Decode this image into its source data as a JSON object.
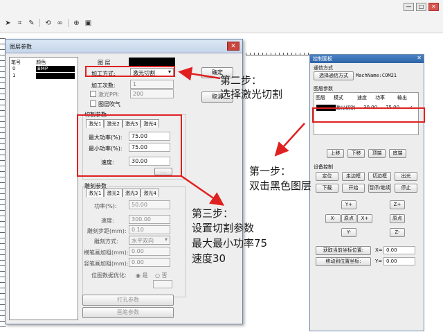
{
  "window": {
    "minimize": "—",
    "maximize": "□",
    "close": "✕"
  },
  "layer_dialog": {
    "title": "图层参数",
    "close": "✕",
    "list_headers": {
      "num": "笔号",
      "color": "颜色"
    },
    "rows": [
      {
        "num": "0",
        "name": "BMP"
      },
      {
        "num": "1",
        "name": ""
      }
    ],
    "layer_label": "图 层",
    "process_mode_label": "加工方式:",
    "process_mode_value": "激光切割",
    "process_count_label": "加工次数:",
    "process_count_value": "1",
    "laser_ppi_label": "激光PPI:",
    "laser_ppi_value": "200",
    "layer_blow_label": "图层吹气",
    "ok_button": "确定",
    "cancel_button": "取消",
    "cut_group_title": "切割参数",
    "cut_tabs": [
      "激光1",
      "激光2",
      "激光3",
      "激光4"
    ],
    "max_power_label": "最大功率(%):",
    "max_power_value": "75.00",
    "min_power_label": "最小功率(%):",
    "min_power_value": "75.00",
    "speed_label": "速度:",
    "speed_value": "30.00",
    "more_button": "....",
    "engrave_group_title": "雕刻参数",
    "engrave_tabs": [
      "激光1",
      "激光2",
      "激光3",
      "激光4"
    ],
    "e_power_label": "功率(%):",
    "e_power_value": "50.00",
    "e_speed_label": "速度:",
    "e_speed_value": "300.00",
    "e_step_label": "雕刻步距(mm):",
    "e_step_value": "0.10",
    "e_mode_label": "雕刻方式:",
    "e_mode_value": "水平双向",
    "e_hbold_label": "横笔画加粗(mm):",
    "e_hbold_value": "0.00",
    "e_vbold_label": "竖笔画加粗(mm):",
    "e_vbold_value": "0.00",
    "e_opt_label": "位图数据优化:",
    "e_opt_yes": "是",
    "e_opt_no": "否",
    "drill_button": "打孔参数",
    "outline_button": "画笔参数"
  },
  "control_panel": {
    "title": "控制面板",
    "comm_label": "通信方式",
    "select_comm_button": "选择通信方式",
    "mach_name": "MachName:COM21",
    "layer_params_label": "图层参数",
    "table_headers": [
      "图层",
      "模式",
      "速度",
      "功率",
      "输出"
    ],
    "table_row": {
      "mode": "激光切割",
      "speed": "30.00",
      "power": "75.00",
      "output": "✓"
    },
    "up_button": "上移",
    "down_button": "下移",
    "top_button": "顶端",
    "bottom_button": "底端",
    "device_label": "设备控制",
    "locate_button": "定位",
    "walk_button": "走边框",
    "cut_frame_button": "切边框",
    "out_light_button": "出光",
    "download_button": "下载",
    "start_button": "开始",
    "pause_button": "暂停/继续",
    "stop_button": "停止",
    "yplus": "Y+",
    "zplus": "Z+",
    "xminus": "X-",
    "origin": "原点",
    "xplus": "X+",
    "origin2": "原点",
    "yminus": "Y-",
    "zminus": "Z-",
    "get_coord_button": "获取当前坐标位置:",
    "x_label": "X=",
    "x_value": "0.00",
    "move_button": "移动到位置坐标:",
    "y_label": "Y=",
    "y_value": "0.00"
  },
  "annotations": {
    "step1_title": "第一步：",
    "step1_text": "双击黑色图层",
    "step2_title": "第二步：",
    "step2_text": "选择激光切割",
    "step3_title": "第三步：",
    "step3_line1": "设置切割参数",
    "step3_line2": "最大最小功率75",
    "step3_line3": "速度30"
  },
  "colors": {
    "annotation_red": "#e02020",
    "titlebar_blue": "#2e64a8",
    "layer_black": "#000000"
  }
}
